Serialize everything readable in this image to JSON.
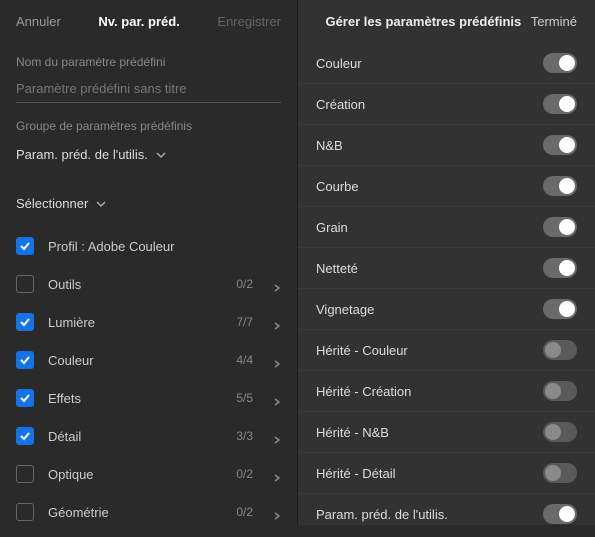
{
  "left": {
    "header": {
      "cancel": "Annuler",
      "title": "Nv. par. préd.",
      "save": "Enregistrer"
    },
    "name_label": "Nom du paramètre prédéfini",
    "name_placeholder": "Paramètre prédéfini sans titre",
    "name_value": "",
    "group_label": "Groupe de paramètres prédéfinis",
    "group_value": "Param. préd. de l'utilis.",
    "select_label": "Sélectionner",
    "items": [
      {
        "label": "Profil : Adobe Couleur",
        "checked": true,
        "count": "",
        "expandable": false
      },
      {
        "label": "Outils",
        "checked": false,
        "count": "0/2",
        "expandable": true
      },
      {
        "label": "Lumière",
        "checked": true,
        "count": "7/7",
        "expandable": true
      },
      {
        "label": "Couleur",
        "checked": true,
        "count": "4/4",
        "expandable": true
      },
      {
        "label": "Effets",
        "checked": true,
        "count": "5/5",
        "expandable": true
      },
      {
        "label": "Détail",
        "checked": true,
        "count": "3/3",
        "expandable": true
      },
      {
        "label": "Optique",
        "checked": false,
        "count": "0/2",
        "expandable": true
      },
      {
        "label": "Géométrie",
        "checked": false,
        "count": "0/2",
        "expandable": true
      }
    ]
  },
  "right": {
    "header": {
      "title": "Gérer les paramètres prédéfinis",
      "done": "Terminé"
    },
    "toggles": [
      {
        "label": "Couleur",
        "on": true
      },
      {
        "label": "Création",
        "on": true
      },
      {
        "label": "N&B",
        "on": true
      },
      {
        "label": "Courbe",
        "on": true
      },
      {
        "label": "Grain",
        "on": true
      },
      {
        "label": "Netteté",
        "on": true
      },
      {
        "label": "Vignetage",
        "on": true
      },
      {
        "label": "Hérité - Couleur",
        "on": false
      },
      {
        "label": "Hérité - Création",
        "on": false
      },
      {
        "label": "Hérité - N&B",
        "on": false
      },
      {
        "label": "Hérité - Détail",
        "on": false
      },
      {
        "label": "Param. préd. de l'utilis.",
        "on": true
      }
    ]
  }
}
